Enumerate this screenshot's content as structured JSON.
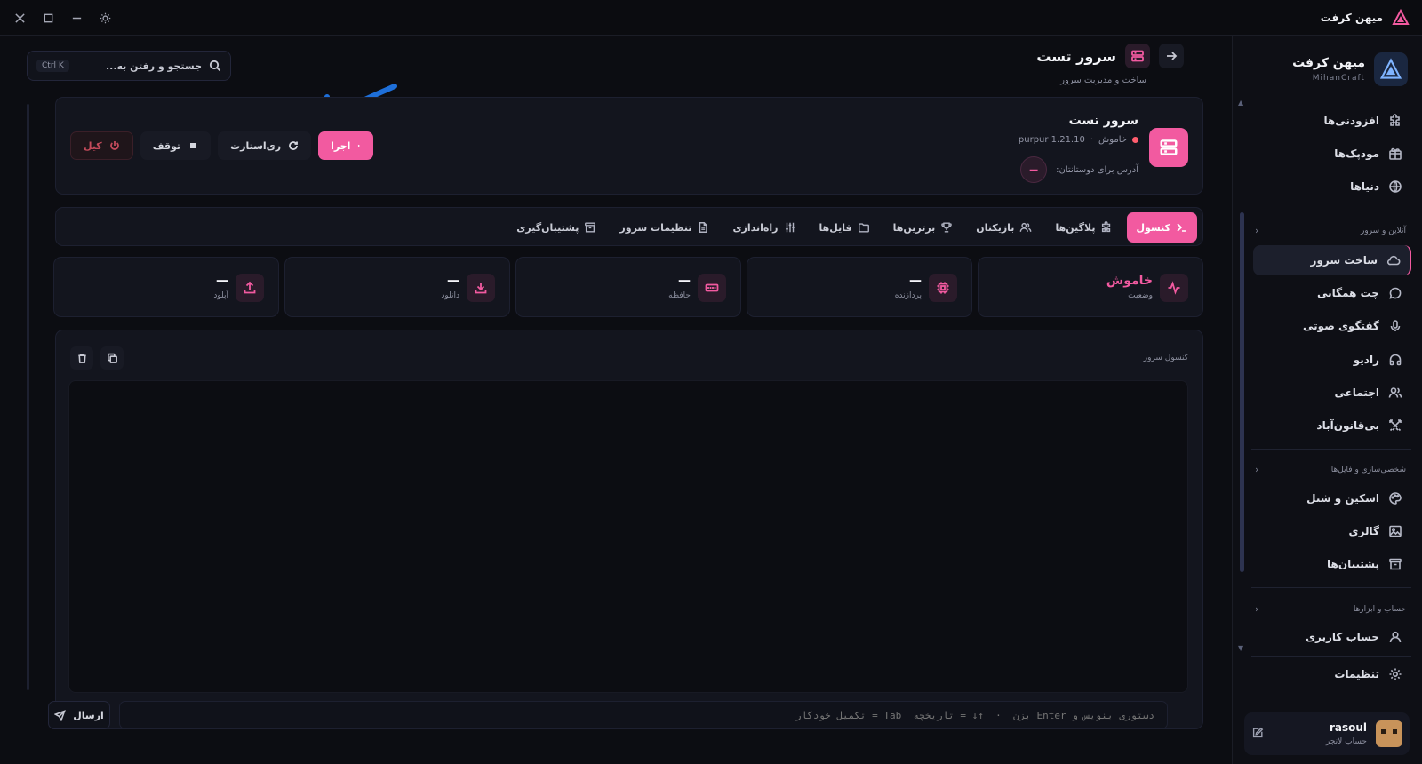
{
  "app": {
    "brand": "میهن کرفت",
    "brand_en": "MihanCraft"
  },
  "search": {
    "placeholder": "جستجو و رفتن به...",
    "shortcut": "Ctrl K"
  },
  "header": {
    "title": "سرور تست",
    "subtitle": "ساخت و مدیریت سرور"
  },
  "server": {
    "name": "سرور تست",
    "status": "خاموش",
    "version": "purpur 1.21.10",
    "address_label": "آدرس برای دوستانتان:",
    "address_value": "—"
  },
  "actions": {
    "run": "اجرا",
    "restart": "ری‌استارت",
    "stop": "توقف",
    "kill": "کیل"
  },
  "tabs": [
    "کنسول",
    "پلاگین‌ها",
    "بازیکنان",
    "برترین‌ها",
    "فایل‌ها",
    "راه‌اندازی",
    "تنظیمات سرور",
    "پشتیبان‌گیری"
  ],
  "stats": [
    {
      "label": "وضعیت",
      "value": "خاموش",
      "icon": "activity-icon"
    },
    {
      "label": "پردازنده",
      "value": "—",
      "icon": "cpu-icon"
    },
    {
      "label": "حافظه",
      "value": "—",
      "icon": "memory-icon"
    },
    {
      "label": "دانلود",
      "value": "—",
      "icon": "download-icon"
    },
    {
      "label": "آپلود",
      "value": "—",
      "icon": "upload-icon"
    }
  ],
  "console": {
    "title": "کنسول سرور",
    "send": "ارسال",
    "placeholder": "دستوری بنویس و Enter بزن  ·  ↑↓ = تاریخچه  Tab = تکمیل خودکار"
  },
  "sidebar": {
    "items_top": [
      "افزودنی‌ها",
      "مودپک‌ها",
      "دنیاها"
    ],
    "section_online": "آنلاین و سرور",
    "items_online": [
      "ساخت سرور",
      "چت همگانی",
      "گفتگوی صوتی",
      "رادیو",
      "اجتماعی",
      "بی‌قانون‌آباد"
    ],
    "section_custom": "شخصی‌سازی و فایل‌ها",
    "items_custom": [
      "اسکین و شنل",
      "گالری",
      "پشتیبان‌ها"
    ],
    "section_account": "حساب و ابزارها",
    "items_account": [
      "حساب کاربری"
    ],
    "settings": "تنظیمات"
  },
  "user": {
    "name": "rasoul",
    "role": "حساب لانچر"
  },
  "colors": {
    "accent": "#f25aa0",
    "background": "#0c0d12",
    "danger": "#ff5d6e",
    "annotation": "#1e6fd9"
  }
}
